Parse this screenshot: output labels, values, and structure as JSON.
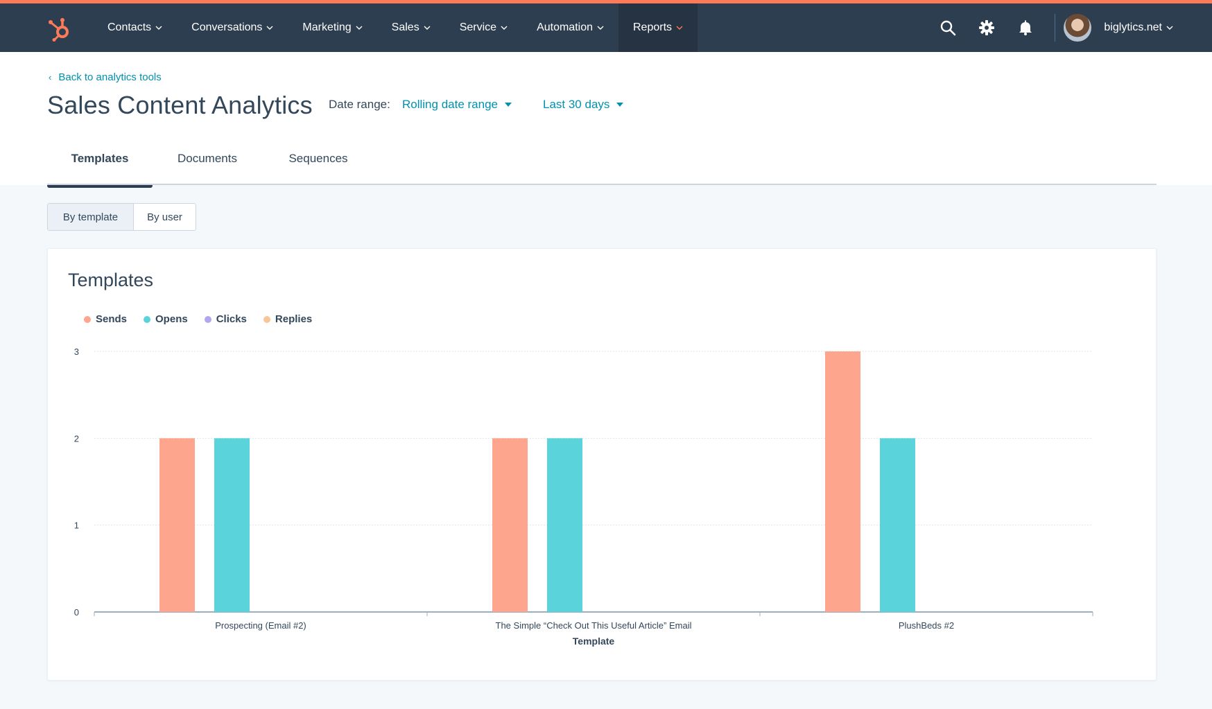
{
  "nav": {
    "items": [
      {
        "label": "Contacts",
        "key": "contacts"
      },
      {
        "label": "Conversations",
        "key": "conversations"
      },
      {
        "label": "Marketing",
        "key": "marketing"
      },
      {
        "label": "Sales",
        "key": "sales"
      },
      {
        "label": "Service",
        "key": "service"
      },
      {
        "label": "Automation",
        "key": "automation"
      },
      {
        "label": "Reports",
        "key": "reports",
        "active": true
      }
    ],
    "account": "biglytics.net",
    "icons": [
      "search-icon",
      "gear-icon",
      "bell-icon"
    ]
  },
  "header": {
    "back_link": "Back to analytics tools",
    "title": "Sales Content Analytics",
    "date_range_label": "Date range:",
    "date_range_type": "Rolling date range",
    "date_range_value": "Last 30 days"
  },
  "tabs": [
    {
      "label": "Templates",
      "active": true
    },
    {
      "label": "Documents"
    },
    {
      "label": "Sequences"
    }
  ],
  "toggle": {
    "by_template": "By template",
    "by_user": "By user"
  },
  "card": {
    "title": "Templates"
  },
  "colors": {
    "brand": "#ff7a59",
    "nav_bg": "#2d3e50",
    "link": "#0091ae",
    "sends": "#fea58e",
    "opens": "#5ad4da",
    "clicks": "#b4a6ee",
    "replies": "#f9c599"
  },
  "chart_data": {
    "type": "bar",
    "categories": [
      "Prospecting (Email #2)",
      "The Simple “Check Out This Useful Article” Email",
      "PlushBeds #2"
    ],
    "series": [
      {
        "name": "Sends",
        "values": [
          2,
          2,
          3
        ],
        "color": "#fea58e"
      },
      {
        "name": "Opens",
        "values": [
          2,
          2,
          2
        ],
        "color": "#5ad4da"
      },
      {
        "name": "Clicks",
        "values": [
          0,
          0,
          0
        ],
        "color": "#b4a6ee"
      },
      {
        "name": "Replies",
        "values": [
          0,
          0,
          0
        ],
        "color": "#f9c599"
      }
    ],
    "xlabel": "Template",
    "ylabel": "",
    "ylim": [
      0,
      3
    ],
    "yticks": [
      0,
      1,
      2,
      3
    ],
    "grid": true,
    "legend": "top-left"
  }
}
